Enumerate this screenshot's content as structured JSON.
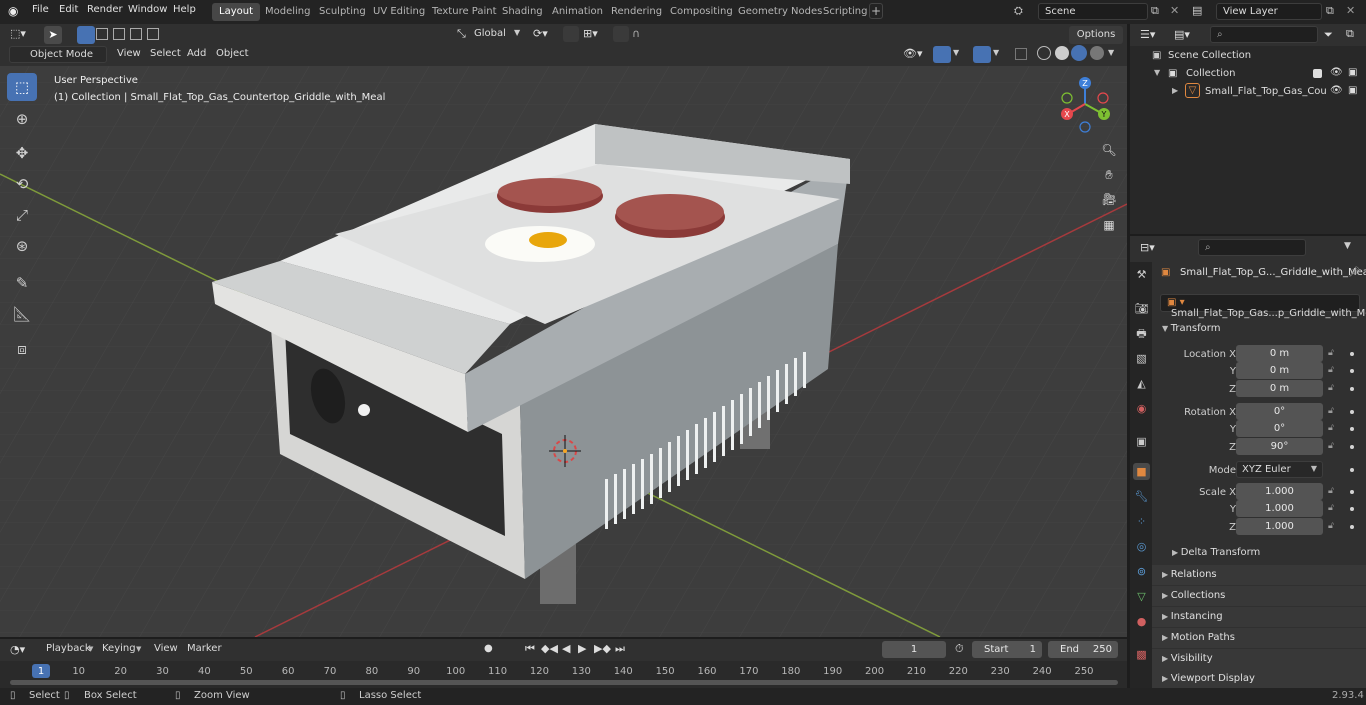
{
  "menu": [
    "File",
    "Edit",
    "Render",
    "Window",
    "Help"
  ],
  "workspaces": [
    "Layout",
    "Modeling",
    "Sculpting",
    "UV Editing",
    "Texture Paint",
    "Shading",
    "Animation",
    "Rendering",
    "Compositing",
    "Geometry Nodes",
    "Scripting"
  ],
  "active_workspace": "Layout",
  "scene": {
    "name": "Scene"
  },
  "view_layer": {
    "name": "View Layer"
  },
  "viewport": {
    "mode": "Object Mode",
    "header_menu": [
      "View",
      "Select",
      "Add",
      "Object"
    ],
    "transform_orientation": "Global",
    "options_label": "Options",
    "perspective_label": "User Perspective",
    "collection_label": "(1) Collection | Small_Flat_Top_Gas_Countertop_Griddle_with_Meal",
    "gizmo_axes": {
      "x": "X",
      "y": "Y",
      "z": "Z"
    }
  },
  "outliner": {
    "scene_collection": "Scene Collection",
    "collection": "Collection",
    "object": "Small_Flat_Top_Gas_Cou"
  },
  "properties": {
    "object_name": "Small_Flat_Top_G..._Griddle_with_Meal",
    "data_name": "Small_Flat_Top_Gas...p_Griddle_with_Meal",
    "transform_header": "Transform",
    "location_label": "Location X",
    "rotation_label": "Rotation X",
    "scale_label": "Scale X",
    "y_label": "Y",
    "z_label": "Z",
    "location": [
      "0 m",
      "0 m",
      "0 m"
    ],
    "rotation": [
      "0°",
      "0°",
      "90°"
    ],
    "mode_label": "Mode",
    "mode_value": "XYZ Euler",
    "scale": [
      "1.000",
      "1.000",
      "1.000"
    ],
    "delta_transform": "Delta Transform",
    "panels": [
      "Relations",
      "Collections",
      "Instancing",
      "Motion Paths",
      "Visibility",
      "Viewport Display"
    ]
  },
  "timeline": {
    "menu": [
      "Playback",
      "Keying",
      "View",
      "Marker"
    ],
    "current_frame": "1",
    "start_label": "Start",
    "start": "1",
    "end_label": "End",
    "end": "250",
    "ticks": [
      "1",
      "10",
      "20",
      "30",
      "40",
      "50",
      "60",
      "70",
      "80",
      "90",
      "100",
      "110",
      "120",
      "130",
      "140",
      "150",
      "160",
      "170",
      "180",
      "190",
      "200",
      "210",
      "220",
      "230",
      "240",
      "250"
    ]
  },
  "status_bar": {
    "select": "Select",
    "box_select": "Box Select",
    "zoom_view": "Zoom View",
    "lasso_select": "Lasso Select",
    "version": "2.93.4"
  },
  "colors": {
    "accent": "#4772b3",
    "header": "#232323",
    "panel": "#303030",
    "viewport": "#3d3d3d",
    "axis_x": "#e5484d",
    "axis_y": "#7ec032",
    "axis_z": "#3e7fd8"
  }
}
